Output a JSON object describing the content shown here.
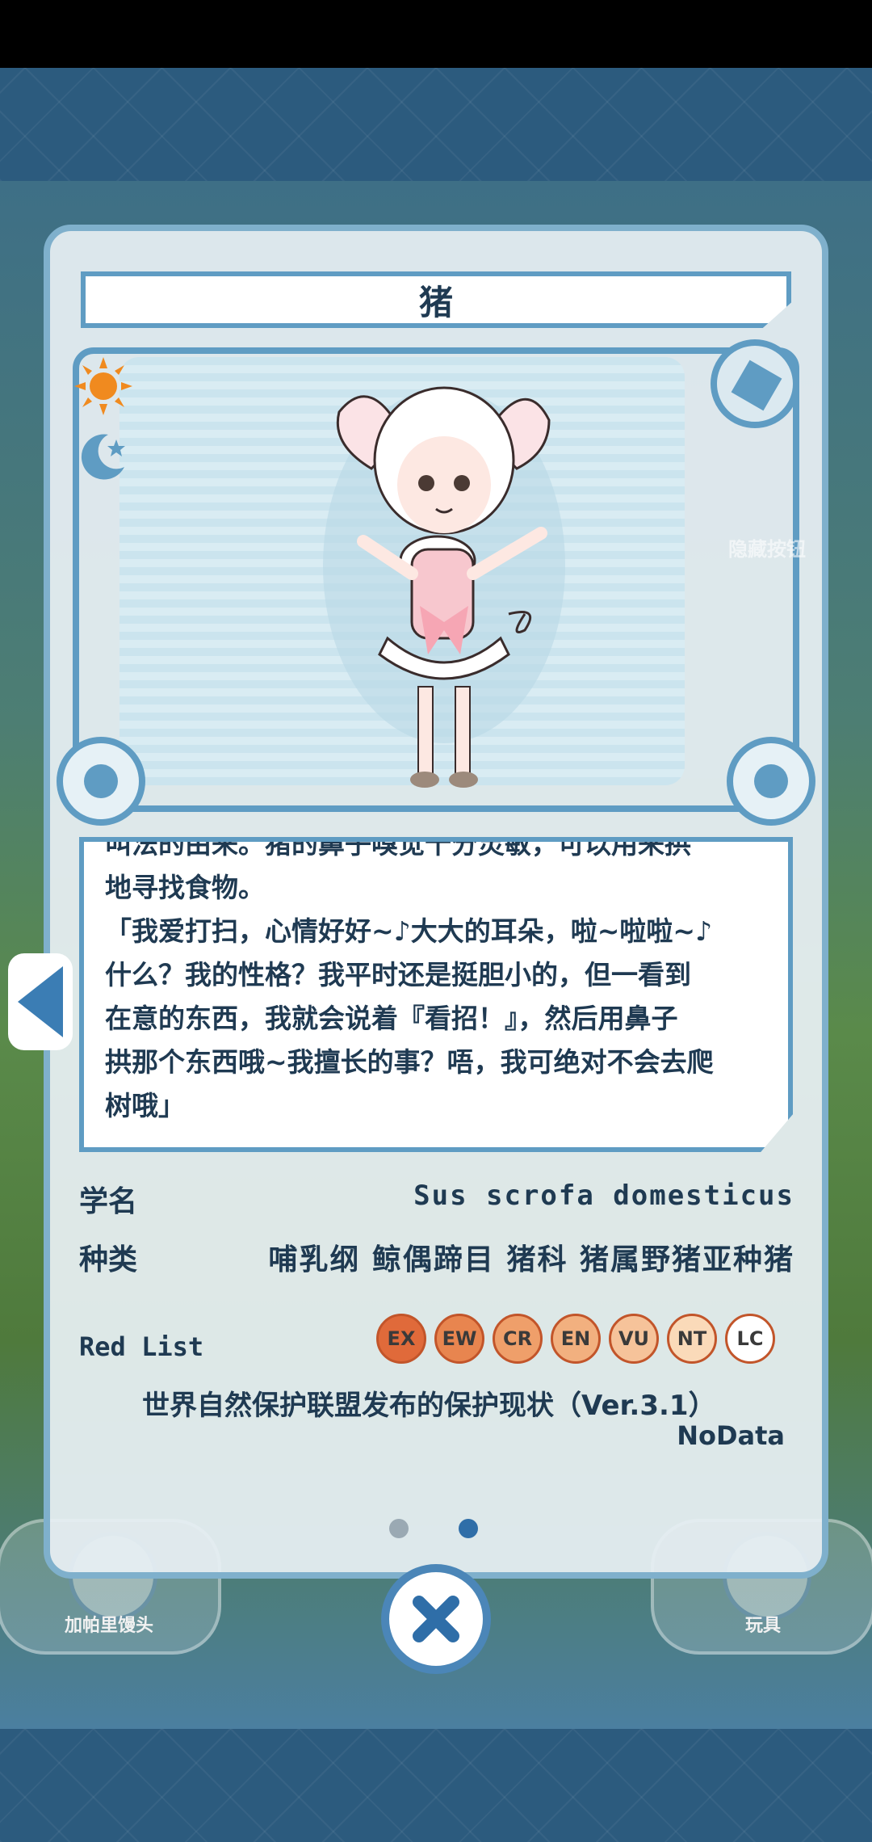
{
  "title": "猪",
  "description": "叫法的由来。猪的鼻子嗅觉十分灵敏，可以用来拱\n地寻找食物。\n「我爱打扫，心情好好~♪大大的耳朵，啦~啦啦~♪\n什么？我的性格？我平时还是挺胆小的，但一看到\n在意的东西，我就会说着『看招！』，然后用鼻子\n拱那个东西哦~我擅长的事？唔，我可绝对不会去爬\n树哦」",
  "scientific_name": {
    "label": "学名",
    "value": "Sus scrofa domesticus"
  },
  "classification": {
    "label": "种类",
    "value": "哺乳纲 鲸偶蹄目 猪科 猪属野猪亚种猪"
  },
  "red_list": {
    "label": "Red List",
    "categories": [
      {
        "code": "EX",
        "color": "#e06a3a"
      },
      {
        "code": "EW",
        "color": "#e8854f"
      },
      {
        "code": "CR",
        "color": "#ef9f6a"
      },
      {
        "code": "EN",
        "color": "#f2b07f"
      },
      {
        "code": "VU",
        "color": "#f6c39a"
      },
      {
        "code": "NT",
        "color": "#fadab9"
      },
      {
        "code": "LC",
        "color": "#ffffff"
      }
    ],
    "source_text": "世界自然保护联盟发布的保护现状（Ver.3.1）",
    "status": "NoData"
  },
  "background_buttons": {
    "left_label": "加帕里馒头",
    "right_label": "玩具"
  },
  "hide_button_label": "隐藏按钮",
  "pagination": {
    "total": 2,
    "current": 2
  },
  "icons": {
    "sun": "sun-icon",
    "moon": "moon-icon",
    "prev": "left-arrow-icon",
    "close": "close-icon"
  }
}
